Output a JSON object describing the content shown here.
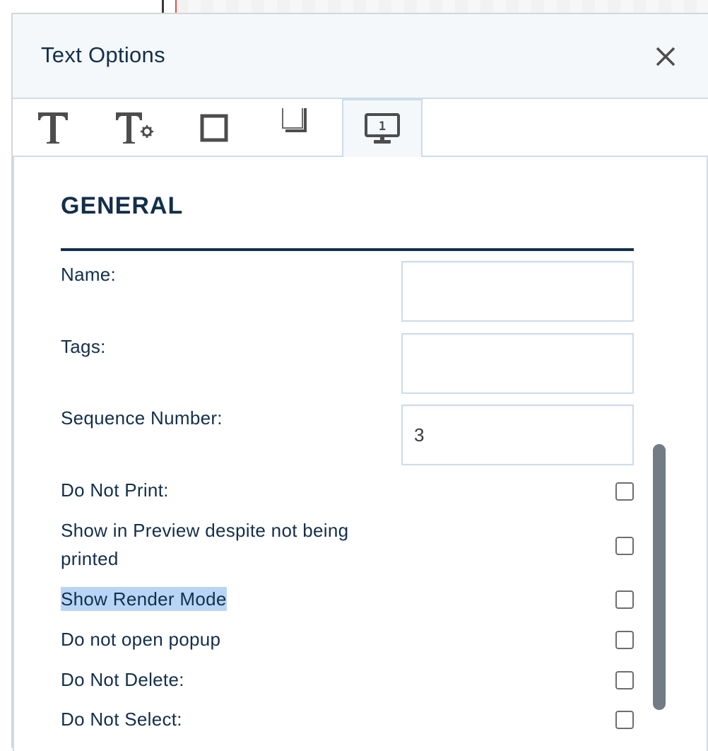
{
  "dialog": {
    "title": "Text Options",
    "close_icon": "close-icon"
  },
  "tabs": [
    {
      "icon": "text-icon",
      "active": false
    },
    {
      "icon": "text-settings-icon",
      "active": false
    },
    {
      "icon": "border-box-icon",
      "active": false
    },
    {
      "icon": "shadow-box-icon",
      "active": false
    },
    {
      "icon": "monitor-number-icon",
      "active": true
    }
  ],
  "section": {
    "title": "GENERAL"
  },
  "fields": {
    "name": {
      "label": "Name:",
      "value": ""
    },
    "tags": {
      "label": "Tags:",
      "value": ""
    },
    "sequence_number": {
      "label": "Sequence Number:",
      "value": "3"
    }
  },
  "checkboxes": [
    {
      "label": "Do Not Print:",
      "checked": false
    },
    {
      "label": "Show in Preview despite not being printed",
      "checked": false
    },
    {
      "label": "Show Render Mode",
      "checked": false,
      "highlighted": true
    },
    {
      "label": "Do not open popup",
      "checked": false
    },
    {
      "label": "Do Not Delete:",
      "checked": false
    },
    {
      "label": "Do Not Select:",
      "checked": false
    }
  ],
  "colors": {
    "title_text": "#142f4a",
    "header_bg": "#f4f8fb",
    "border": "#cddcea",
    "selection_highlight": "#b8d5f7",
    "scrollbar": "#737b84",
    "icon": "#4d4d4d"
  }
}
